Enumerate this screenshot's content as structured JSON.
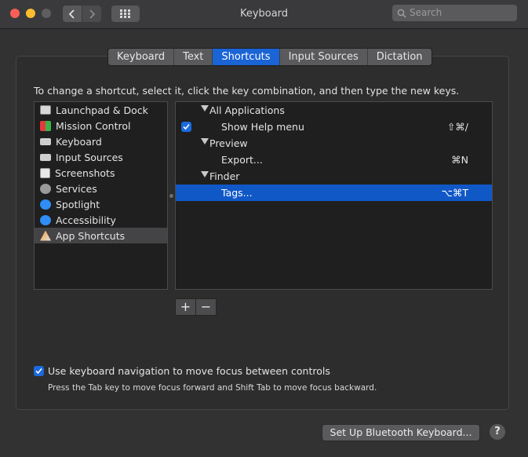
{
  "window": {
    "title": "Keyboard"
  },
  "search": {
    "placeholder": "Search"
  },
  "tabs": [
    "Keyboard",
    "Text",
    "Shortcuts",
    "Input Sources",
    "Dictation"
  ],
  "active_tab": "Shortcuts",
  "instruction": "To change a shortcut, select it, click the key combination, and then type the new keys.",
  "categories": [
    {
      "label": "Launchpad & Dock",
      "icon": "launchpad-dock-icon"
    },
    {
      "label": "Mission Control",
      "icon": "mission-control-icon"
    },
    {
      "label": "Keyboard",
      "icon": "keyboard-icon"
    },
    {
      "label": "Input Sources",
      "icon": "input-sources-icon"
    },
    {
      "label": "Screenshots",
      "icon": "screenshots-icon"
    },
    {
      "label": "Services",
      "icon": "gear-icon"
    },
    {
      "label": "Spotlight",
      "icon": "spotlight-icon"
    },
    {
      "label": "Accessibility",
      "icon": "accessibility-icon"
    },
    {
      "label": "App Shortcuts",
      "icon": "app-shortcuts-icon",
      "selected": true
    }
  ],
  "shortcuts": {
    "groups": [
      {
        "name": "All Applications",
        "items": [
          {
            "label": "Show Help menu",
            "key": "⇧⌘/",
            "checked": true
          }
        ]
      },
      {
        "name": "Preview",
        "items": [
          {
            "label": "Export...",
            "key": "⌘N"
          }
        ]
      },
      {
        "name": "Finder",
        "items": [
          {
            "label": "Tags...",
            "key": "⌥⌘T",
            "selected": true
          }
        ]
      }
    ]
  },
  "buttons": {
    "add": "+",
    "remove": "−",
    "bluetooth": "Set Up Bluetooth Keyboard...",
    "help": "?"
  },
  "keyboard_nav": {
    "checked": true,
    "label": "Use keyboard navigation to move focus between controls",
    "hint": "Press the Tab key to move focus forward and Shift Tab to move focus backward."
  },
  "colors": {
    "accent": "#1a64d6",
    "selection": "#1158c7",
    "background": "#323232"
  }
}
